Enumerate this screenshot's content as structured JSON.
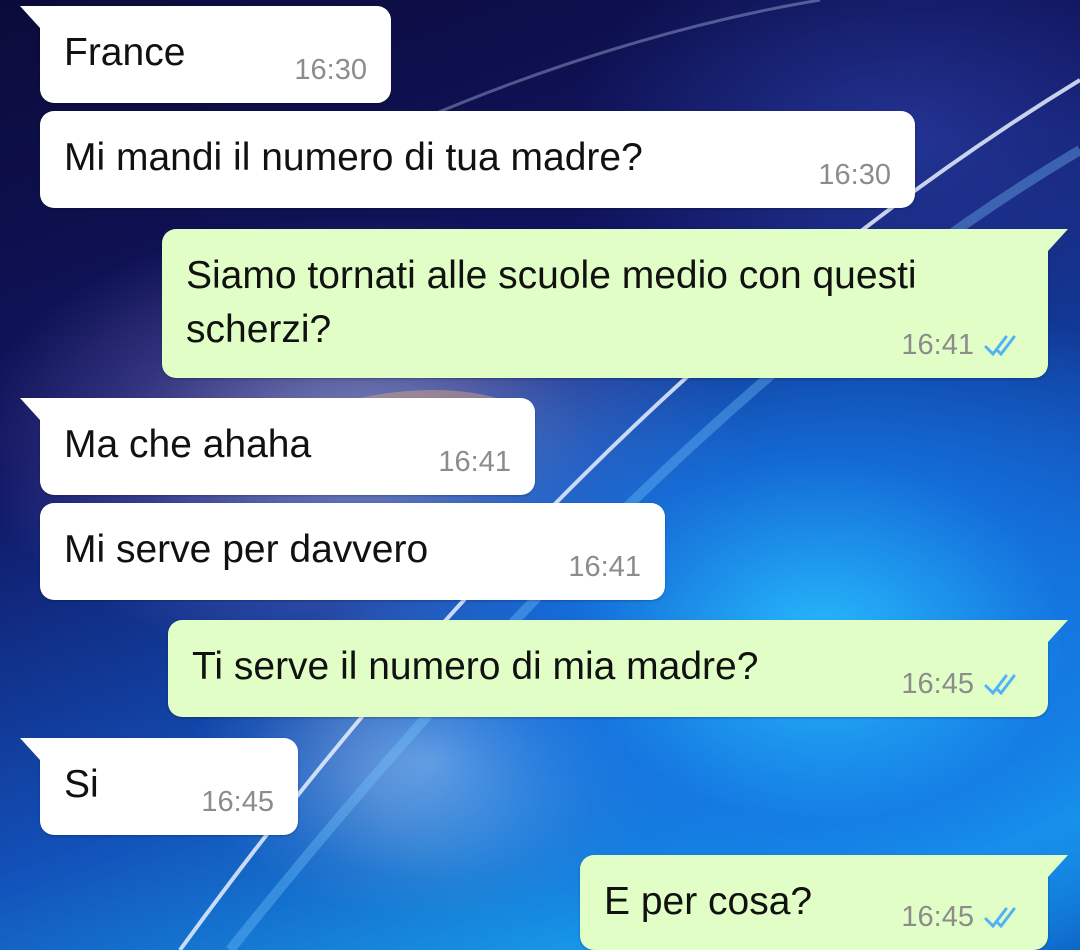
{
  "chat": {
    "messages": [
      {
        "direction": "in",
        "text": "France",
        "time": "16:30"
      },
      {
        "direction": "in",
        "text": "Mi mandi il numero di tua madre?",
        "time": "16:30"
      },
      {
        "direction": "out",
        "text": "Siamo tornati alle scuole medio con questi scherzi?",
        "time": "16:41",
        "status_icon": "double-check-read-icon"
      },
      {
        "direction": "in",
        "text": "Ma che ahaha",
        "time": "16:41"
      },
      {
        "direction": "in",
        "text": "Mi serve per davvero",
        "time": "16:41"
      },
      {
        "direction": "out",
        "text": "Ti serve il numero di mia madre?",
        "time": "16:45",
        "status_icon": "double-check-read-icon"
      },
      {
        "direction": "in",
        "text": "Si",
        "time": "16:45"
      },
      {
        "direction": "out",
        "text": "E per cosa?",
        "time": "16:45",
        "status_icon": "double-check-read-icon"
      }
    ]
  },
  "colors": {
    "incoming_bubble": "#ffffff",
    "outgoing_bubble": "#e1fec6",
    "read_ticks": "#4fb3f6",
    "timestamp": "#8c8c8c"
  }
}
